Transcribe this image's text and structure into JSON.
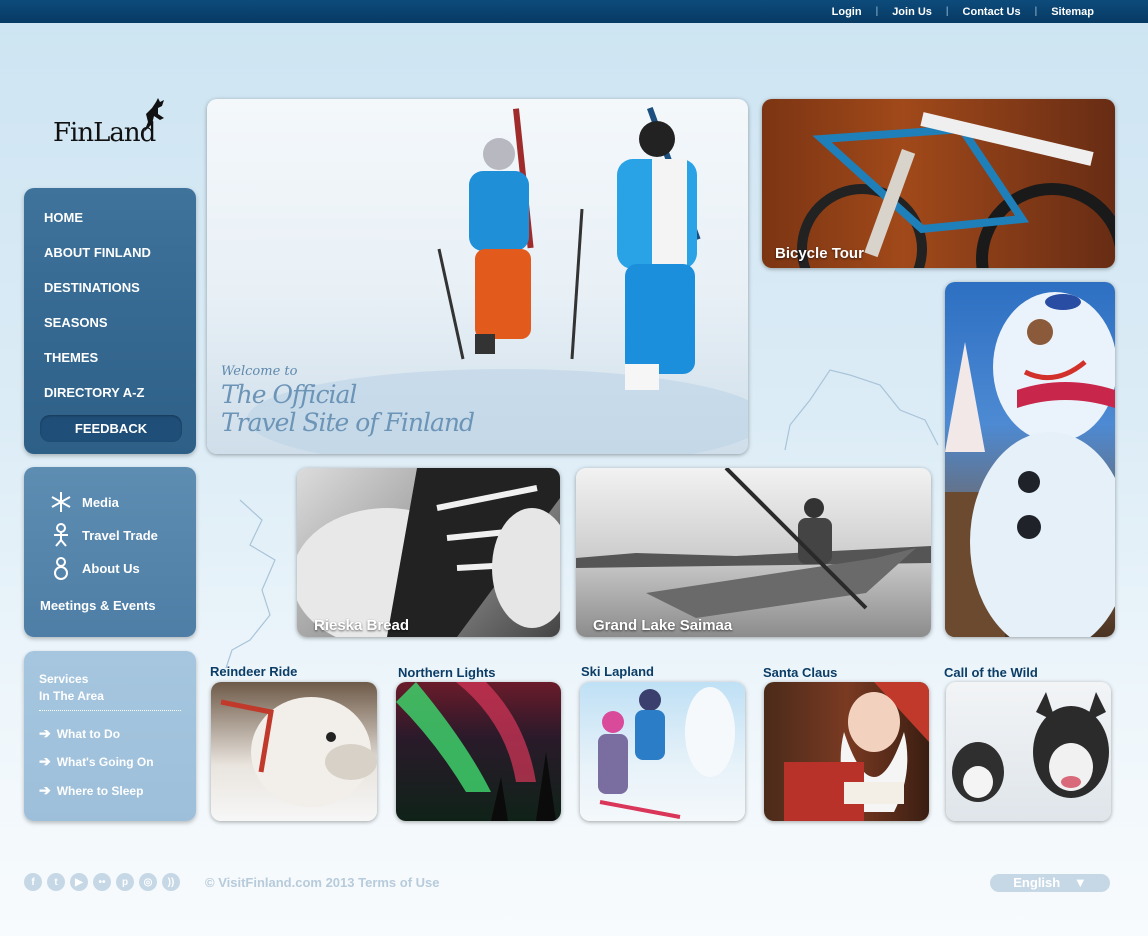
{
  "topnav": {
    "login": "Login",
    "join": "Join Us",
    "contact": "Contact Us",
    "sitemap": "Sitemap",
    "separator": "|"
  },
  "logo": {
    "text": "FinLand"
  },
  "mainnav": {
    "items": [
      "HOME",
      "ABOUT FINLAND",
      "DESTINATIONS",
      "SEASONS",
      "THEMES",
      "DIRECTORY A-Z"
    ],
    "feedback": "FEEDBACK"
  },
  "secondary": {
    "media": "Media",
    "trade": "Travel Trade",
    "about": "About Us",
    "meetings": "Meetings & Events"
  },
  "services": {
    "title_line1": "Services",
    "title_line2": "In The Area",
    "items": [
      "What to Do",
      "What's Going On",
      "Where to Sleep"
    ]
  },
  "hero": {
    "welcome": "Welcome to",
    "title_line1": "The Official",
    "title_line2": "Travel Site of Finland"
  },
  "tiles": {
    "bicycle": "Bicycle Tour",
    "bread": "Rieska Bread",
    "lake": "Grand Lake Saimaa"
  },
  "thumbs": [
    "Reindeer Ride",
    "Northern Lights",
    "Ski Lapland",
    "Santa Claus",
    "Call of the Wild"
  ],
  "footer": {
    "icons": [
      "facebook-icon",
      "twitter-icon",
      "youtube-icon",
      "flickr-icon",
      "pinterest-icon",
      "instagram-icon",
      "rss-icon"
    ],
    "copyright": "© VisitFinland.com 2013 Terms of Use",
    "language": "English"
  },
  "colors": {
    "topbar": "#0d4b7c",
    "nav": "#3f739b",
    "accent": "#0b3d66"
  }
}
